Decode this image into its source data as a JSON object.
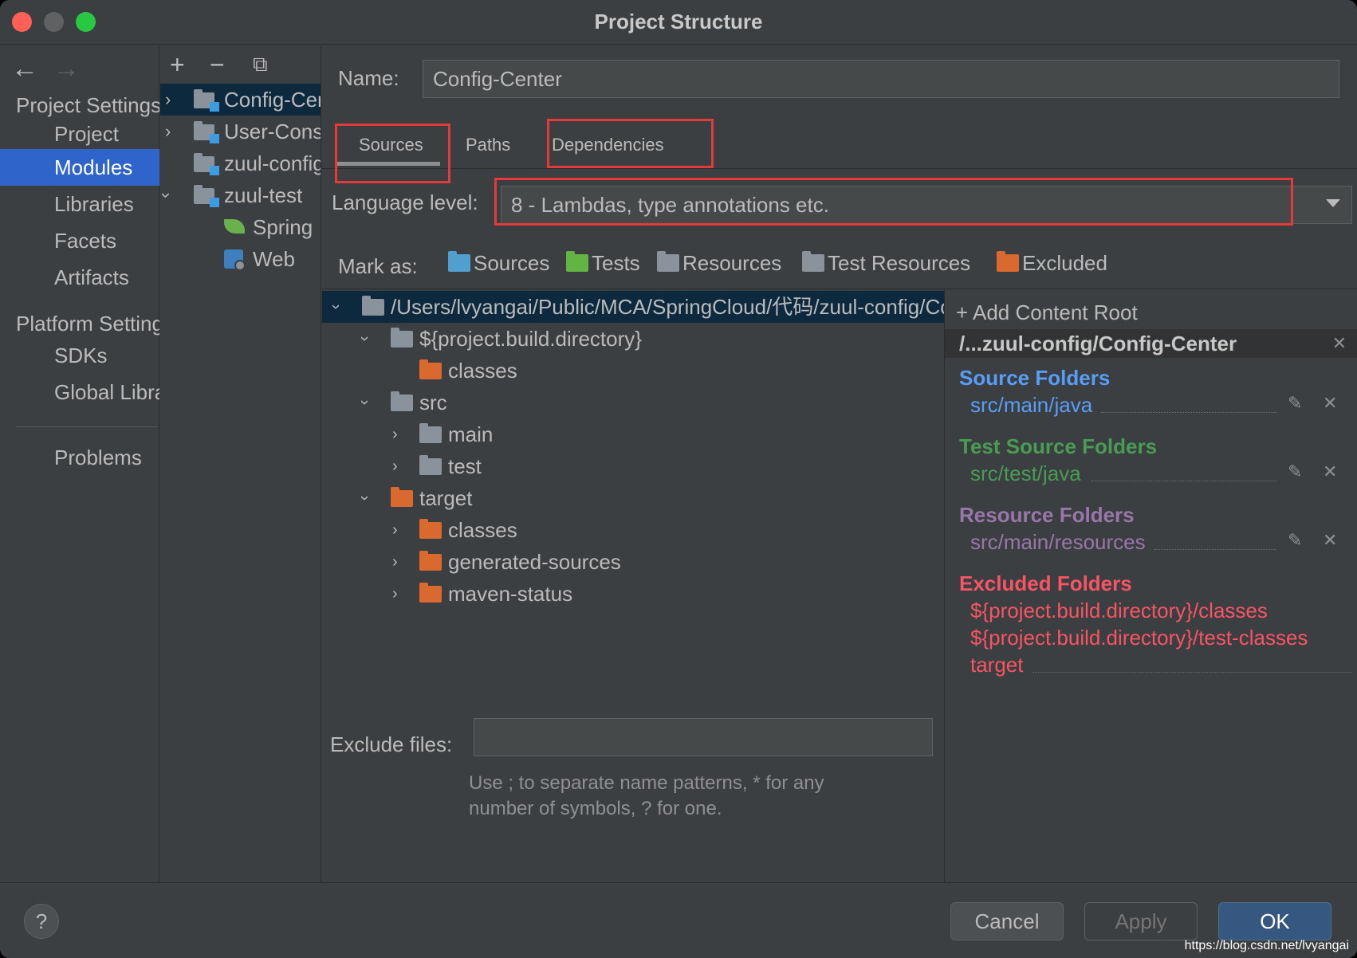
{
  "window": {
    "title": "Project Structure"
  },
  "left_nav": {
    "project_settings_header": "Project Settings",
    "project_settings_items": [
      {
        "label": "Project",
        "selected": false
      },
      {
        "label": "Modules",
        "selected": true
      },
      {
        "label": "Libraries",
        "selected": false
      },
      {
        "label": "Facets",
        "selected": false
      },
      {
        "label": "Artifacts",
        "selected": false
      }
    ],
    "platform_settings_header": "Platform Settings",
    "platform_settings_items": [
      {
        "label": "SDKs"
      },
      {
        "label": "Global Libraries"
      }
    ],
    "problems_label": "Problems"
  },
  "module_tree": {
    "toolbar": [
      "add-icon",
      "remove-icon",
      "copy-icon"
    ],
    "items": [
      {
        "label": "Config-Center",
        "selected": true
      },
      {
        "label": "User-Consumer"
      },
      {
        "label": "zuul-config"
      },
      {
        "label": "zuul-test"
      },
      {
        "label": "Spring"
      },
      {
        "label": "Web"
      }
    ]
  },
  "module": {
    "name_label": "Name:",
    "name_value": "Config-Center",
    "tabs": [
      "Sources",
      "Paths",
      "Dependencies"
    ],
    "active_tab": "Sources",
    "language_level_label": "Language level:",
    "language_level_value": "8 - Lambdas, type annotations etc.",
    "mark_as_label": "Mark as:",
    "mark_as": [
      {
        "label": "Sources",
        "color": "#4f9fcf"
      },
      {
        "label": "Tests",
        "color": "#62b543"
      },
      {
        "label": "Resources",
        "color": "#8a939b"
      },
      {
        "label": "Test Resources",
        "color": "#8a939b"
      },
      {
        "label": "Excluded",
        "color": "#d9692f"
      }
    ],
    "exclude_files_label": "Exclude files:",
    "exclude_files_value": "",
    "exclude_hint_line1": "Use ; to separate name patterns, * for any",
    "exclude_hint_line2": "number of symbols, ? for one."
  },
  "content_tree": [
    {
      "label": "/Users/lvyangai/Public/MCA/SpringCloud/代码/zuul-config/Config-Center",
      "color": "#8a939b",
      "expanded": true
    },
    {
      "label": "${project.build.directory}",
      "color": "#8a939b",
      "expanded": true
    },
    {
      "label": "classes",
      "color": "#d9692f"
    },
    {
      "label": "src",
      "color": "#8a939b",
      "expanded": true
    },
    {
      "label": "main",
      "color": "#8a939b",
      "expanded": false
    },
    {
      "label": "test",
      "color": "#8a939b",
      "expanded": false
    },
    {
      "label": "target",
      "color": "#d9692f",
      "expanded": true
    },
    {
      "label": "classes",
      "color": "#d9692f",
      "expanded": false
    },
    {
      "label": "generated-sources",
      "color": "#d9692f",
      "expanded": false
    },
    {
      "label": "maven-status",
      "color": "#d9692f",
      "expanded": false
    }
  ],
  "content_root_panel": {
    "add_content_root": "Add Content Root",
    "root_path": "/...zuul-config/Config-Center",
    "source_folders": {
      "title": "Source Folders",
      "color": "#589df6",
      "paths": [
        "src/main/java"
      ]
    },
    "test_source_folders": {
      "title": "Test Source Folders",
      "color": "#499c54",
      "paths": [
        "src/test/java"
      ]
    },
    "resource_folders": {
      "title": "Resource Folders",
      "color": "#9876aa",
      "paths": [
        "src/main/resources"
      ]
    },
    "excluded_folders": {
      "title": "Excluded Folders",
      "color": "#f75464",
      "paths": [
        "${project.build.directory}/classes",
        "${project.build.directory}/test-classes",
        "target"
      ]
    }
  },
  "buttons": {
    "help": "?",
    "cancel": "Cancel",
    "apply": "Apply",
    "ok": "OK"
  },
  "watermark": "https://blog.csdn.net/lvyangai"
}
